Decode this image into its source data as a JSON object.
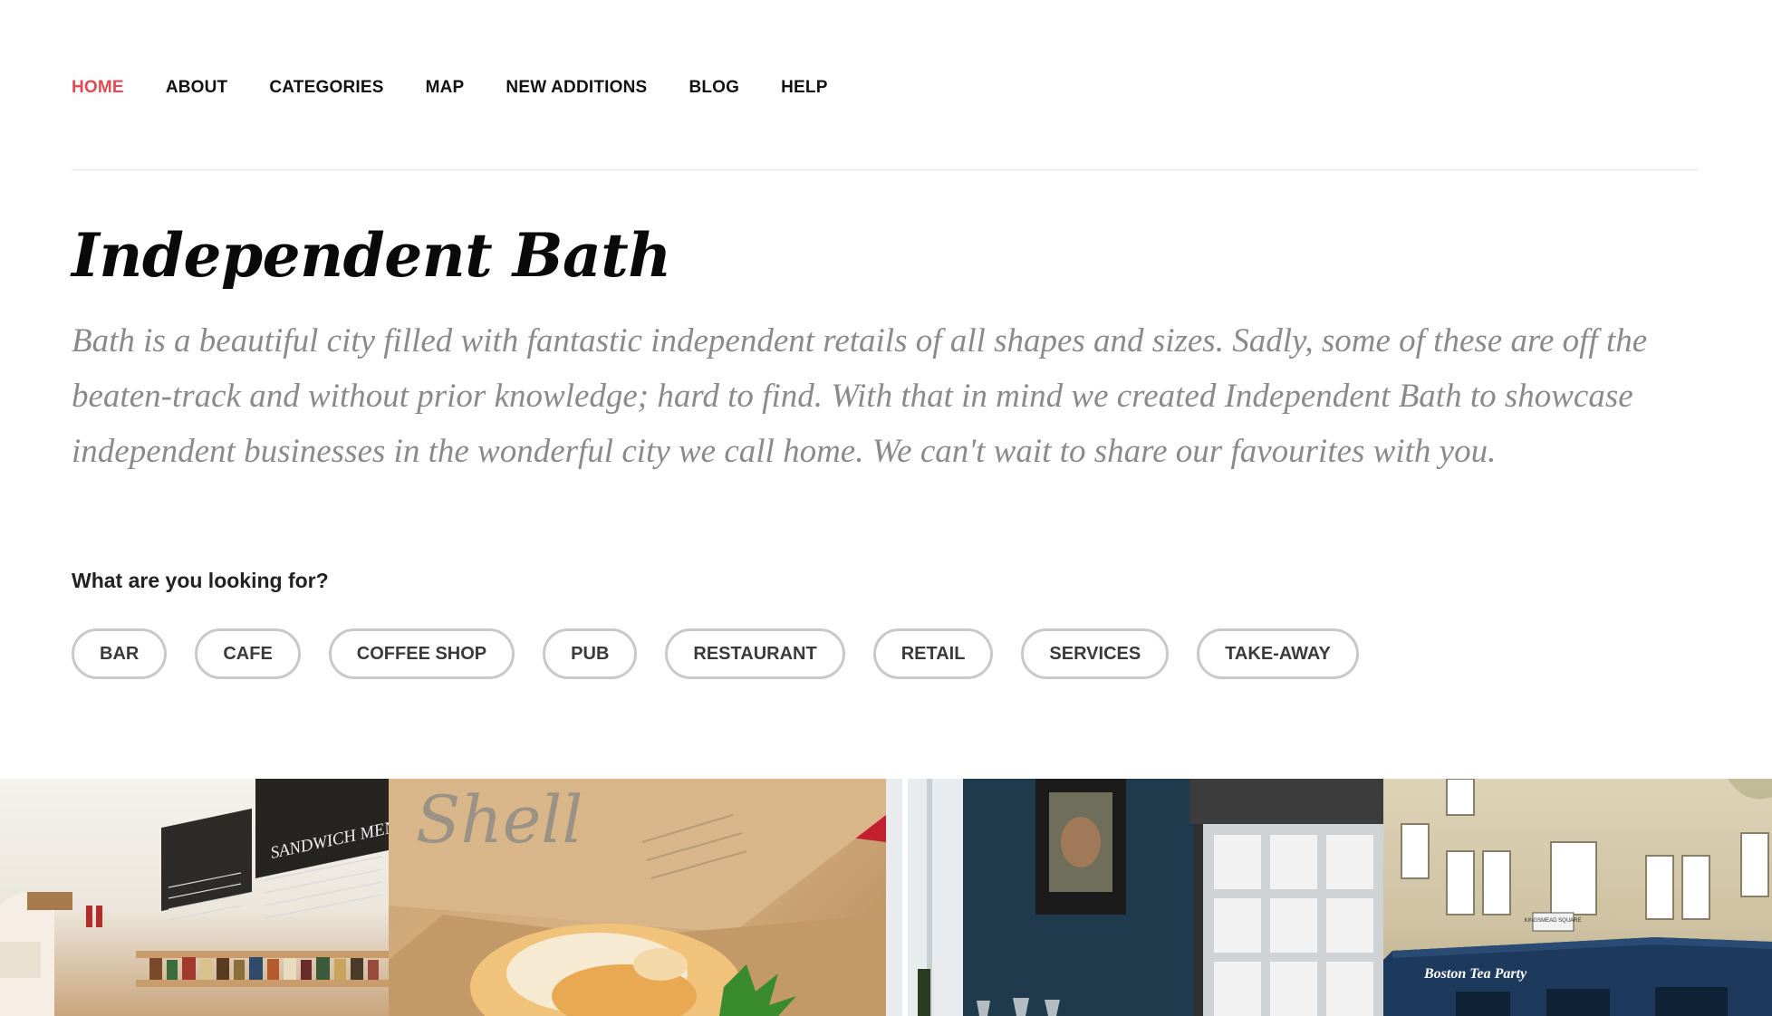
{
  "nav": {
    "items": [
      {
        "label": "HOME",
        "active": true
      },
      {
        "label": "ABOUT",
        "active": false
      },
      {
        "label": "CATEGORIES",
        "active": false
      },
      {
        "label": "MAP",
        "active": false
      },
      {
        "label": "NEW ADDITIONS",
        "active": false
      },
      {
        "label": "BLOG",
        "active": false
      },
      {
        "label": "HELP",
        "active": false
      }
    ]
  },
  "hero": {
    "title": "Independent Bath",
    "intro": "Bath is a beautiful city filled with fantastic independent retails of all shapes and sizes. Sadly, some of these are off the beaten-track and without prior knowledge; hard to find. With that in mind we created Independent Bath to showcase independent businesses in the wonderful city we call home. We can't wait to share our favourites with you."
  },
  "search": {
    "question": "What are you looking for?",
    "categories": [
      "BAR",
      "CAFE",
      "COFFEE SHOP",
      "PUB",
      "RESTAURANT",
      "RETAIL",
      "SERVICES",
      "TAKE-AWAY"
    ]
  },
  "gallery": {
    "photos": [
      {
        "name": "sandwich-deli-photo",
        "chalkboard": "SANDWICH MENU"
      },
      {
        "name": "fish-and-chips-photo",
        "box_text": "Shell"
      },
      {
        "name": "restaurant-interior-photo"
      },
      {
        "name": "boston-tea-party-photo",
        "signage": "Boston Tea Party",
        "street_sign": "KINGSMEAD SQUARE"
      }
    ]
  },
  "colors": {
    "accent": "#e04a55",
    "text": "#111111",
    "intro_text": "#8a8a8a",
    "chip_border": "#c9c9c9"
  }
}
